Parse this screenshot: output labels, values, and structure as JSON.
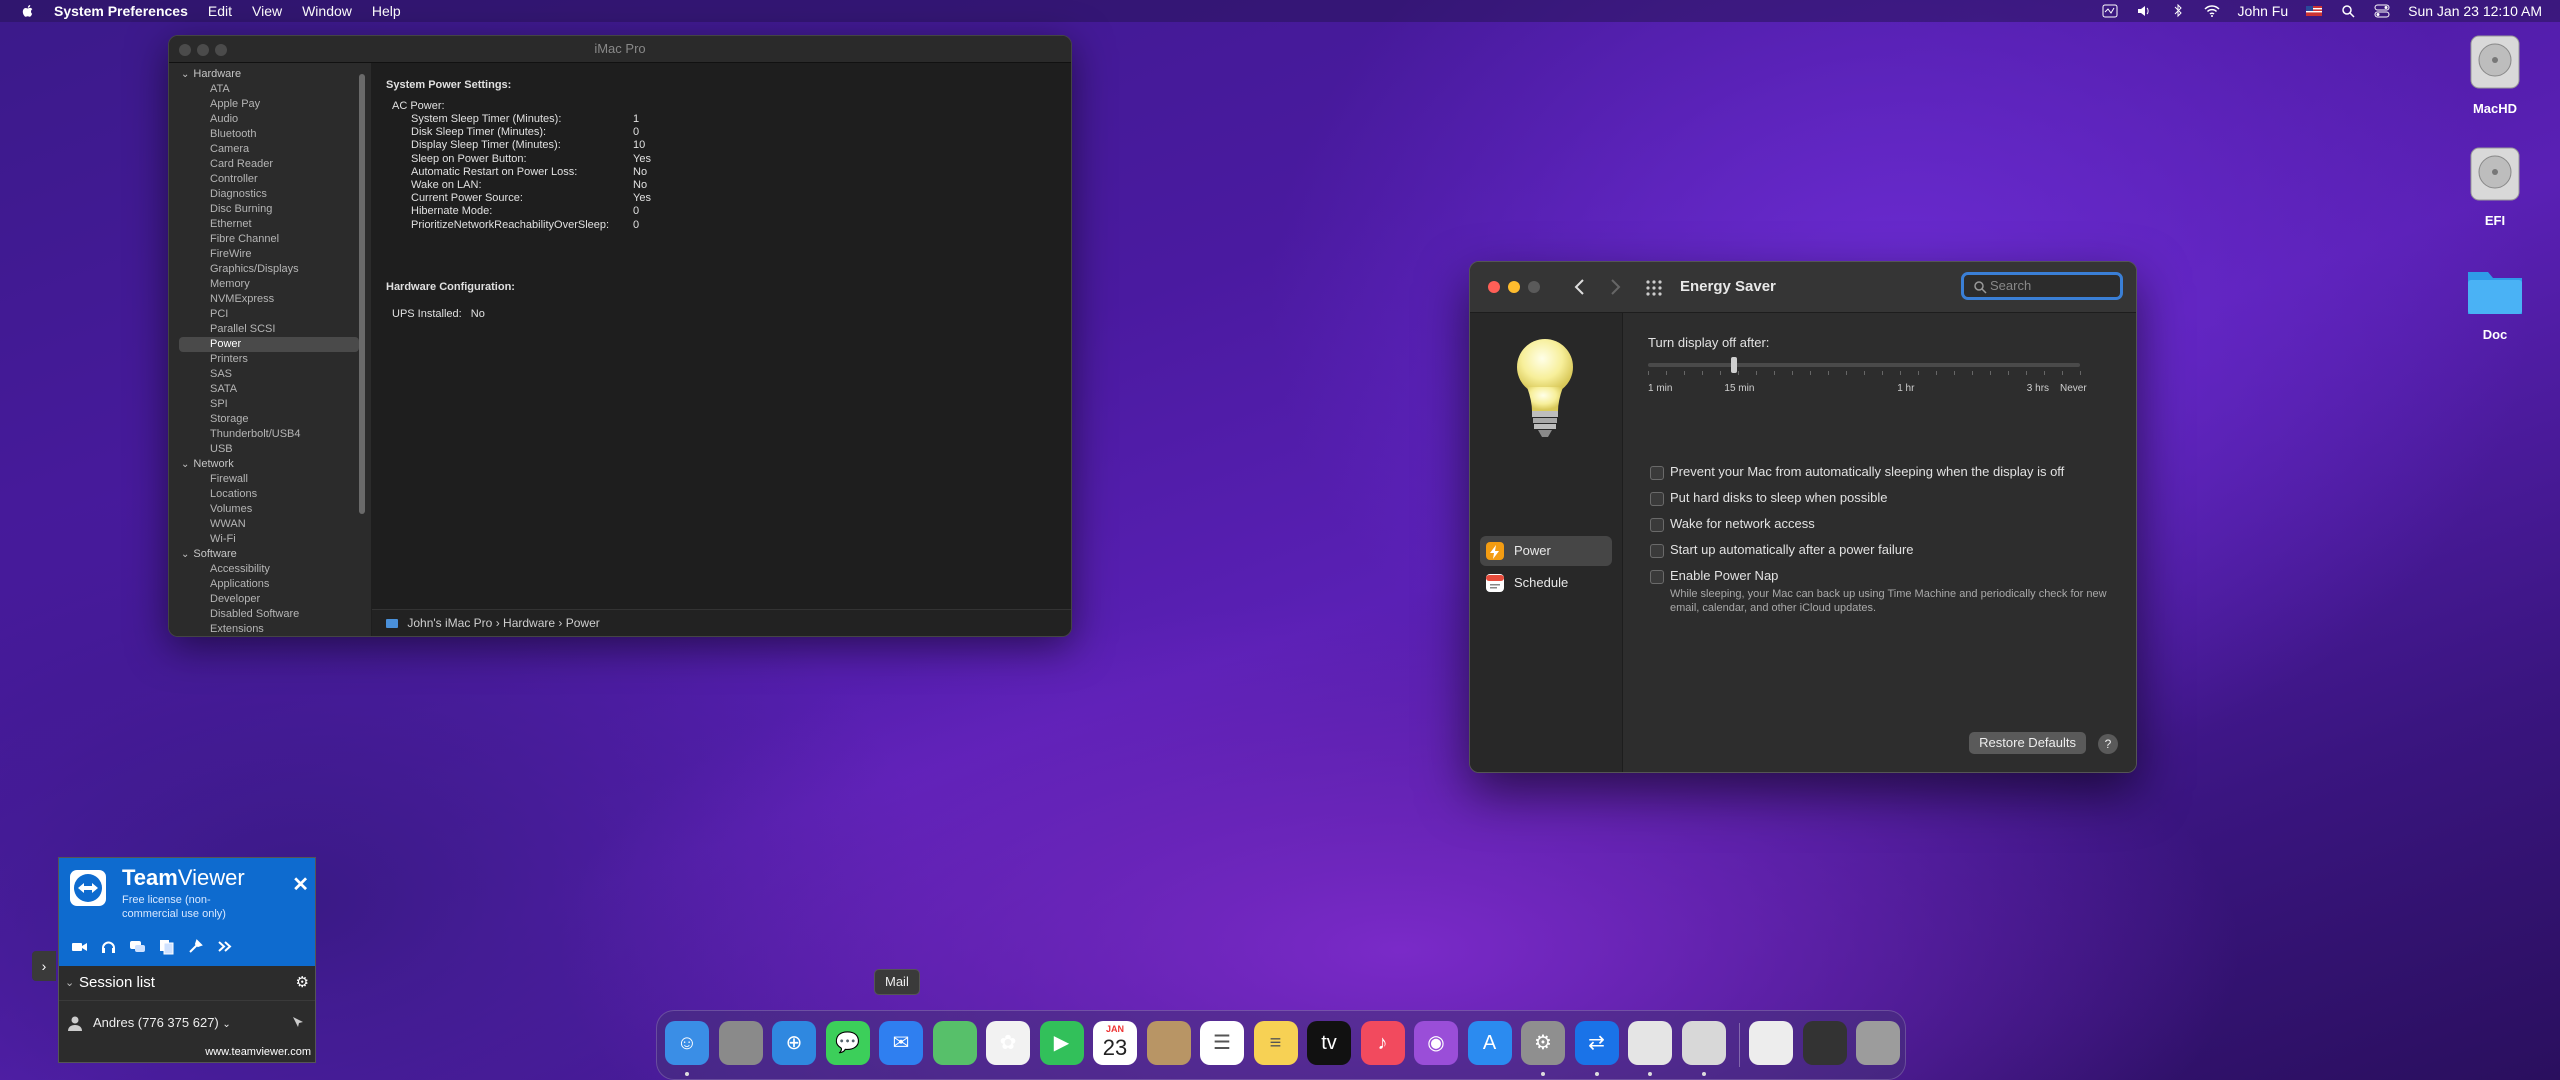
{
  "menubar": {
    "app": "System Preferences",
    "items": [
      "Edit",
      "View",
      "Window",
      "Help"
    ],
    "user": "John Fu",
    "clock": "Sun Jan 23  12:10 AM"
  },
  "desktop": {
    "icons": [
      {
        "label": "MacHD",
        "icon": "hard-drive-icon"
      },
      {
        "label": "EFI",
        "icon": "hard-drive-icon"
      },
      {
        "label": "Doc",
        "icon": "folder-icon"
      }
    ]
  },
  "sysinfo": {
    "title": "iMac Pro",
    "sidebar": {
      "hardware_label": "Hardware",
      "hardware": [
        "ATA",
        "Apple Pay",
        "Audio",
        "Bluetooth",
        "Camera",
        "Card Reader",
        "Controller",
        "Diagnostics",
        "Disc Burning",
        "Ethernet",
        "Fibre Channel",
        "FireWire",
        "Graphics/Displays",
        "Memory",
        "NVMExpress",
        "PCI",
        "Parallel SCSI",
        "Power",
        "Printers",
        "SAS",
        "SATA",
        "SPI",
        "Storage",
        "Thunderbolt/USB4",
        "USB"
      ],
      "network_label": "Network",
      "network": [
        "Firewall",
        "Locations",
        "Volumes",
        "WWAN",
        "Wi-Fi"
      ],
      "software_label": "Software",
      "software": [
        "Accessibility",
        "Applications",
        "Developer",
        "Disabled Software",
        "Extensions"
      ],
      "selected": "Power"
    },
    "main": {
      "heading": "System Power Settings:",
      "ac_label": "AC Power:",
      "settings": [
        {
          "k": "System Sleep Timer (Minutes):",
          "v": "1"
        },
        {
          "k": "Disk Sleep Timer (Minutes):",
          "v": "0"
        },
        {
          "k": "Display Sleep Timer (Minutes):",
          "v": "10"
        },
        {
          "k": "Sleep on Power Button:",
          "v": "Yes"
        },
        {
          "k": "Automatic Restart on Power Loss:",
          "v": "No"
        },
        {
          "k": "Wake on LAN:",
          "v": "No"
        },
        {
          "k": "Current Power Source:",
          "v": "Yes"
        },
        {
          "k": "Hibernate Mode:",
          "v": "0"
        },
        {
          "k": "PrioritizeNetworkReachabilityOverSleep:",
          "v": "0"
        }
      ],
      "hw_heading": "Hardware Configuration:",
      "ups_label": "UPS Installed:",
      "ups_value": "No"
    },
    "breadcrumb": [
      "John's iMac Pro",
      "Hardware",
      "Power"
    ]
  },
  "energy": {
    "title": "Energy Saver",
    "search_placeholder": "Search",
    "nav": [
      {
        "label": "Power"
      },
      {
        "label": "Schedule"
      }
    ],
    "slider_label": "Turn display off after:",
    "slider_ticks": [
      "1 min",
      "15 min",
      "1 hr",
      "3 hrs",
      "Never"
    ],
    "slider_value_fraction": 0.2,
    "checkboxes": [
      "Prevent your Mac from automatically sleeping when the display is off",
      "Put hard disks to sleep when possible",
      "Wake for network access",
      "Start up automatically after a power failure",
      "Enable Power Nap"
    ],
    "power_nap_desc": "While sleeping, your Mac can back up using Time Machine and periodically check for new email, calendar, and other iCloud updates.",
    "restore_label": "Restore Defaults",
    "help_label": "?"
  },
  "teamviewer": {
    "brand_bold": "Team",
    "brand_rest": "Viewer",
    "license": "Free license (non-commercial use only)",
    "session_label": "Session list",
    "user": "Andres (776 375 627)",
    "url": "www.teamviewer.com"
  },
  "dock": {
    "tooltip": "Mail",
    "calendar_month": "JAN",
    "calendar_day": "23",
    "apps": [
      "Finder",
      "Launchpad",
      "Safari",
      "Messages",
      "Mail",
      "Maps",
      "Photos",
      "FaceTime",
      "Calendar",
      "Contacts",
      "Reminders",
      "Notes",
      "TV",
      "Music",
      "Podcasts",
      "App Store",
      "System Preferences",
      "TeamViewer",
      "Preview",
      "Disk Utility",
      "Document",
      "Screenshot",
      "Trash"
    ]
  }
}
